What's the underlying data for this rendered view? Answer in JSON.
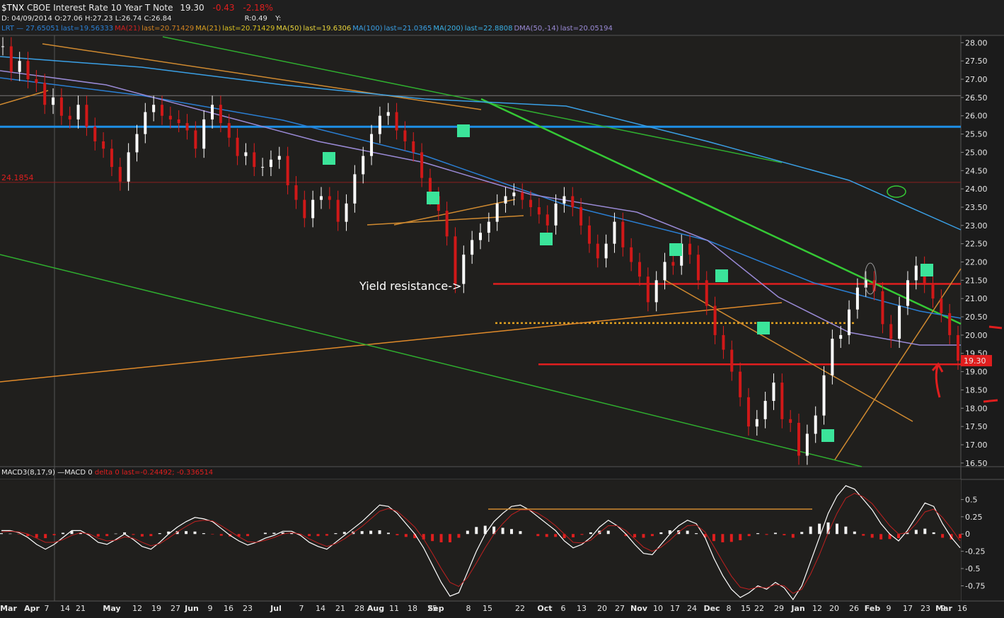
{
  "header": {
    "symbol": "$TNX",
    "name": "CBOE Interest Rate 10 Year T Note",
    "last": "19.30",
    "change": "-0.43",
    "change_pct": "-2.18%",
    "line2_date": "D: 04/09/2014",
    "line2_o": "O:27.06",
    "line2_h": "H:27.23",
    "line2_l": "L:26.74",
    "line2_c": "C:26.84",
    "line2_r": "R:0.49",
    "line2_y": "Y:"
  },
  "studies": [
    {
      "text": "LRT — 27.65051",
      "color": "#2a7fd4"
    },
    {
      "text": "last=19.56333",
      "color": "#2a7fd4"
    },
    {
      "text": "MA(21)",
      "color": "#d02020"
    },
    {
      "text": "last=20.71429",
      "color": "#d08020"
    },
    {
      "text": "MA(21)",
      "color": "#d9a020"
    },
    {
      "text": "last=20.71429",
      "color": "#d9c020"
    },
    {
      "text": "MA(50)",
      "color": "#e6d23a"
    },
    {
      "text": "last=19.6306",
      "color": "#e6d23a"
    },
    {
      "text": "MA(100)",
      "color": "#3aa0e6"
    },
    {
      "text": "last=21.0365",
      "color": "#3aa0e6"
    },
    {
      "text": "MA(200)",
      "color": "#3ab0e6"
    },
    {
      "text": "last=22.8808",
      "color": "#3ab0e6"
    },
    {
      "text": "DMA(50,-14)",
      "color": "#9a8ad6"
    },
    {
      "text": "last=20.05194",
      "color": "#9a8ad6"
    }
  ],
  "chart_data": {
    "type": "candlestick",
    "title": "$TNX CBOE Interest Rate 10 Year T Note",
    "y_ticks": [
      "28.00",
      "27.50",
      "27.00",
      "26.50",
      "26.00",
      "25.50",
      "25.00",
      "24.50",
      "24.00",
      "23.50",
      "23.00",
      "22.50",
      "22.00",
      "21.50",
      "21.00",
      "20.50",
      "20.00",
      "19.50",
      "19.00",
      "18.50",
      "18.00",
      "17.50",
      "17.00",
      "16.50"
    ],
    "ylim": [
      16.4,
      28.2
    ],
    "x_ticks": [
      "Mar",
      "Apr",
      "7",
      "14",
      "21",
      "May",
      "12",
      "19",
      "27",
      "Jun",
      "9",
      "16",
      "23",
      "Jul",
      "7",
      "14",
      "21",
      "28",
      "Aug",
      "11",
      "18",
      "25",
      "Sep",
      "8",
      "15",
      "22",
      "Oct",
      "6",
      "13",
      "20",
      "27",
      "Nov",
      "10",
      "17",
      "24",
      "Dec",
      "8",
      "15",
      "22",
      "29",
      "Jan",
      "12",
      "20",
      "26",
      "Feb",
      "9",
      "17",
      "23",
      "Mar",
      "9",
      "16"
    ],
    "marker_left_label": "24.1854",
    "annotation": "Yield resistance->",
    "last_value_label": "19.30",
    "horizontal_levels": [
      {
        "name": "blue",
        "value": 25.7,
        "color": "#1e8fe6"
      },
      {
        "name": "red-upper",
        "value": 21.4,
        "color": "#e01e1e"
      },
      {
        "name": "red-lower",
        "value": 19.2,
        "color": "#e01e1e"
      },
      {
        "name": "orange-dotted",
        "value": 20.33,
        "color": "#e0a020"
      },
      {
        "name": "thin-red",
        "value": 24.18,
        "color": "#8a2020"
      },
      {
        "name": "gray",
        "value": 26.55,
        "color": "#777777"
      }
    ],
    "price_path": [
      27.9,
      27.2,
      27.5,
      27.0,
      26.9,
      26.3,
      26.5,
      26.0,
      25.9,
      26.3,
      25.7,
      25.3,
      25.1,
      24.6,
      24.2,
      25.0,
      25.5,
      26.1,
      26.3,
      26.0,
      25.9,
      25.8,
      25.6,
      25.1,
      25.9,
      26.3,
      25.8,
      25.4,
      24.9,
      25.0,
      24.6,
      24.6,
      24.8,
      24.9,
      24.1,
      23.7,
      23.2,
      23.7,
      23.8,
      23.7,
      23.1,
      23.6,
      24.4,
      24.9,
      25.5,
      26.0,
      26.1,
      25.6,
      25.3,
      25.0,
      24.3,
      23.8,
      23.4,
      22.7,
      21.4,
      22.2,
      22.6,
      22.8,
      23.1,
      23.6,
      23.8,
      23.9,
      23.7,
      23.5,
      23.3,
      23.0,
      23.6,
      23.8,
      23.5,
      23.0,
      22.5,
      22.1,
      22.5,
      23.1,
      22.4,
      22.0,
      21.6,
      20.9,
      21.5,
      22.0,
      21.9,
      22.5,
      22.2,
      21.5,
      20.8,
      20.0,
      19.6,
      19.0,
      18.3,
      17.5,
      17.7,
      18.2,
      18.7,
      17.7,
      17.6,
      16.7,
      17.3,
      17.8,
      18.9,
      19.9,
      20.0,
      20.7,
      21.3,
      21.5,
      21.2,
      20.3,
      19.9,
      20.8,
      21.5,
      21.9,
      21.4,
      21.0,
      20.6,
      20.0,
      19.3
    ]
  },
  "macd": {
    "label": "MACD3(8,17,9)",
    "label2": "—MACD 0",
    "label3": "delta 0 last=-0.24492;",
    "label4": "-0.336514",
    "y_ticks": [
      "0.5",
      "0.25",
      "0",
      "-0.25",
      "-0.5",
      "-0.75"
    ],
    "ylim": [
      -0.95,
      0.75
    ],
    "line": [
      0.05,
      0.05,
      0.02,
      -0.05,
      -0.15,
      -0.22,
      -0.15,
      -0.05,
      0.05,
      0.05,
      -0.02,
      -0.12,
      -0.15,
      -0.08,
      0.0,
      -0.08,
      -0.18,
      -0.22,
      -0.12,
      0.0,
      0.1,
      0.18,
      0.24,
      0.22,
      0.18,
      0.08,
      -0.02,
      -0.1,
      -0.16,
      -0.12,
      -0.06,
      -0.02,
      0.04,
      0.04,
      -0.02,
      -0.12,
      -0.18,
      -0.22,
      -0.12,
      -0.02,
      0.08,
      0.18,
      0.3,
      0.42,
      0.4,
      0.3,
      0.15,
      0.0,
      -0.2,
      -0.45,
      -0.7,
      -0.9,
      -0.85,
      -0.55,
      -0.25,
      0.0,
      0.18,
      0.3,
      0.4,
      0.42,
      0.35,
      0.25,
      0.15,
      0.05,
      -0.1,
      -0.2,
      -0.15,
      -0.05,
      0.1,
      0.2,
      0.12,
      0.0,
      -0.15,
      -0.28,
      -0.3,
      -0.15,
      0.0,
      0.12,
      0.2,
      0.15,
      -0.05,
      -0.35,
      -0.6,
      -0.8,
      -0.92,
      -0.85,
      -0.75,
      -0.8,
      -0.7,
      -0.78,
      -0.95,
      -0.75,
      -0.4,
      -0.05,
      0.3,
      0.55,
      0.7,
      0.65,
      0.5,
      0.35,
      0.15,
      0.0,
      -0.1,
      0.05,
      0.25,
      0.45,
      0.4,
      0.15,
      -0.05,
      -0.2
    ],
    "signal": [
      0.03,
      0.04,
      0.03,
      0.0,
      -0.06,
      -0.12,
      -0.12,
      -0.08,
      -0.02,
      0.02,
      0.0,
      -0.06,
      -0.1,
      -0.09,
      -0.04,
      -0.06,
      -0.12,
      -0.17,
      -0.14,
      -0.06,
      0.03,
      0.11,
      0.18,
      0.2,
      0.19,
      0.12,
      0.04,
      -0.04,
      -0.11,
      -0.12,
      -0.09,
      -0.05,
      0.0,
      0.02,
      0.0,
      -0.07,
      -0.13,
      -0.18,
      -0.14,
      -0.07,
      0.02,
      0.11,
      0.22,
      0.33,
      0.37,
      0.33,
      0.22,
      0.1,
      -0.07,
      -0.28,
      -0.5,
      -0.7,
      -0.76,
      -0.63,
      -0.42,
      -0.2,
      0.0,
      0.15,
      0.28,
      0.35,
      0.35,
      0.3,
      0.22,
      0.12,
      0.0,
      -0.12,
      -0.13,
      -0.09,
      0.02,
      0.12,
      0.12,
      0.05,
      -0.07,
      -0.19,
      -0.25,
      -0.19,
      -0.09,
      0.03,
      0.12,
      0.13,
      0.03,
      -0.18,
      -0.4,
      -0.61,
      -0.77,
      -0.8,
      -0.77,
      -0.78,
      -0.73,
      -0.75,
      -0.86,
      -0.8,
      -0.58,
      -0.3,
      0.02,
      0.3,
      0.52,
      0.59,
      0.54,
      0.44,
      0.28,
      0.12,
      0.0,
      0.02,
      0.15,
      0.32,
      0.36,
      0.24,
      0.08,
      -0.1
    ]
  }
}
